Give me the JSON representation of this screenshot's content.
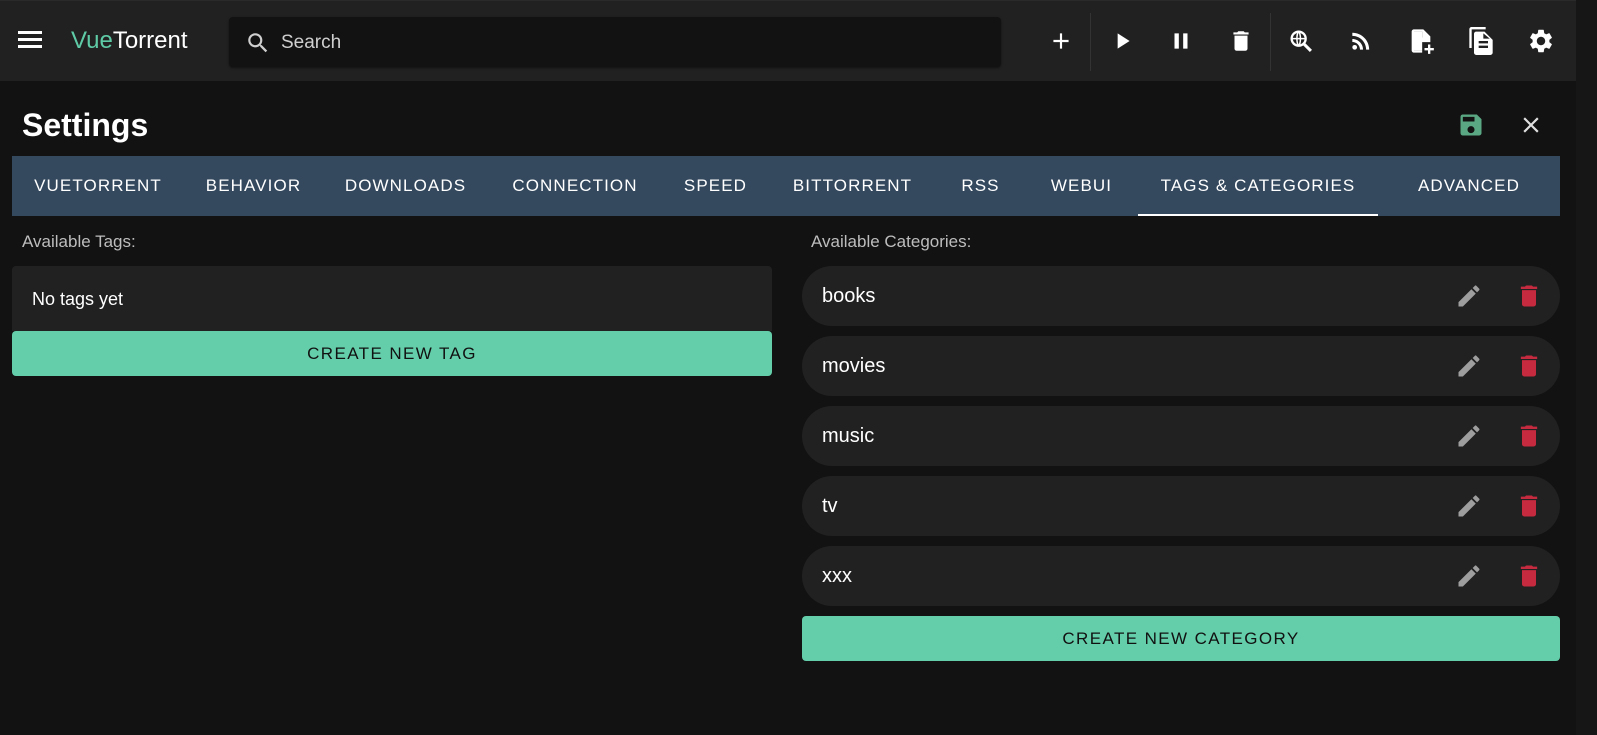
{
  "app": {
    "brand_part1": "Vue",
    "brand_part2": "Torrent",
    "search_placeholder": "Search"
  },
  "toolbar_icons": [
    "menu-icon",
    "plus-icon",
    "play-icon",
    "pause-icon",
    "trash-icon",
    "search-globe-icon",
    "rss-icon",
    "file-plus-icon",
    "logs-icon",
    "gear-icon"
  ],
  "settings": {
    "title": "Settings",
    "tabs": [
      {
        "label": "VUETORRENT",
        "active": false
      },
      {
        "label": "BEHAVIOR",
        "active": false
      },
      {
        "label": "DOWNLOADS",
        "active": false
      },
      {
        "label": "CONNECTION",
        "active": false
      },
      {
        "label": "SPEED",
        "active": false
      },
      {
        "label": "BITTORRENT",
        "active": false
      },
      {
        "label": "RSS",
        "active": false
      },
      {
        "label": "WEBUI",
        "active": false
      },
      {
        "label": "TAGS & CATEGORIES",
        "active": true
      },
      {
        "label": "ADVANCED",
        "active": false
      }
    ]
  },
  "tags": {
    "label": "Available Tags:",
    "empty_text": "No tags yet",
    "create_label": "CREATE NEW TAG"
  },
  "categories": {
    "label": "Available Categories:",
    "items": [
      "books",
      "movies",
      "music",
      "tv",
      "xxx"
    ],
    "create_label": "CREATE NEW CATEGORY"
  },
  "colors": {
    "accent": "#64ceaa",
    "brand": "#5fcba6",
    "tab_bar": "#34495e",
    "delete": "#c62a3e",
    "save_icon": "#5aa783"
  }
}
